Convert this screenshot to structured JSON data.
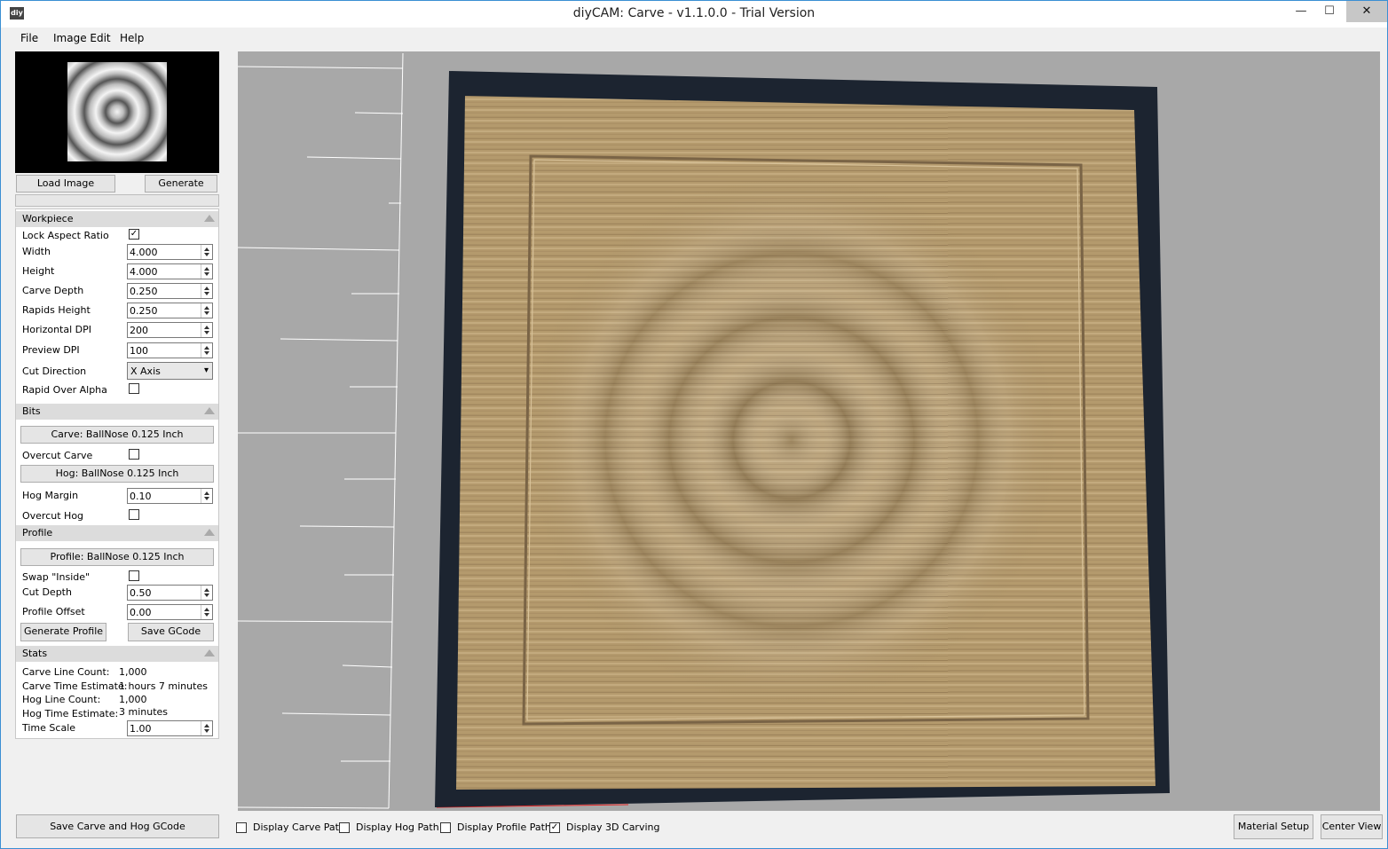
{
  "window": {
    "title": "diyCAM: Carve - v1.1.0.0 - Trial Version",
    "icon_text": "diy",
    "controls": {
      "minimize": "—",
      "maximize": "☐",
      "close": "✕"
    }
  },
  "menu": [
    "File",
    "Image Edit",
    "Help"
  ],
  "left": {
    "load_image": "Load Image",
    "generate": "Generate",
    "workpiece": {
      "title": "Workpiece",
      "lock_aspect_ratio": {
        "label": "Lock Aspect Ratio",
        "checked": "✓"
      },
      "width": {
        "label": "Width",
        "value": "4.000"
      },
      "height": {
        "label": "Height",
        "value": "4.000"
      },
      "carve_depth": {
        "label": "Carve Depth",
        "value": "0.250"
      },
      "rapids_height": {
        "label": "Rapids Height",
        "value": "0.250"
      },
      "horizontal_dpi": {
        "label": "Horizontal DPI",
        "value": "200"
      },
      "preview_dpi": {
        "label": "Preview DPI",
        "value": "100"
      },
      "cut_direction": {
        "label": "Cut Direction",
        "value": "X Axis"
      },
      "rapid_over_alpha": {
        "label": "Rapid Over Alpha"
      }
    },
    "bits": {
      "title": "Bits",
      "carve_bit": "Carve: BallNose 0.125 Inch",
      "overcut_carve": "Overcut Carve",
      "hog_bit": "Hog: BallNose 0.125 Inch",
      "hog_margin": {
        "label": "Hog Margin",
        "value": "0.10"
      },
      "overcut_hog": "Overcut Hog"
    },
    "profile": {
      "title": "Profile",
      "profile_bit": "Profile: BallNose 0.125 Inch",
      "swap_inside": "Swap \"Inside\"",
      "cut_depth": {
        "label": "Cut Depth",
        "value": "0.50"
      },
      "profile_offset": {
        "label": "Profile Offset",
        "value": "0.00"
      },
      "generate_profile": "Generate Profile",
      "save_gcode": "Save GCode"
    },
    "stats": {
      "title": "Stats",
      "carve_line_count": {
        "label": "Carve Line Count:",
        "value": "1,000"
      },
      "carve_time": {
        "label": "Carve Time Estimate:",
        "value": "1 hours 7 minutes"
      },
      "hog_line_count": {
        "label": "Hog Line Count:",
        "value": "1,000"
      },
      "hog_time": {
        "label": "Hog Time Estimate:",
        "value": "3 minutes"
      },
      "time_scale": {
        "label": "Time Scale",
        "value": "1.00"
      }
    },
    "save_all": "Save Carve and Hog GCode"
  },
  "bottom": {
    "display_carve_path": "Display Carve Path",
    "display_hog_path": "Display Hog Path",
    "display_profile_path": "Display Profile Path",
    "display_3d_carving": {
      "label": "Display 3D Carving",
      "checked": "✓"
    },
    "material_setup": "Material Setup",
    "center_view": "Center View"
  },
  "colors": {
    "viewport_bg": "#a8a8a8",
    "wood": "#b59a6e",
    "wood_dark": "#8b7452",
    "board_side": "#1c2430"
  }
}
